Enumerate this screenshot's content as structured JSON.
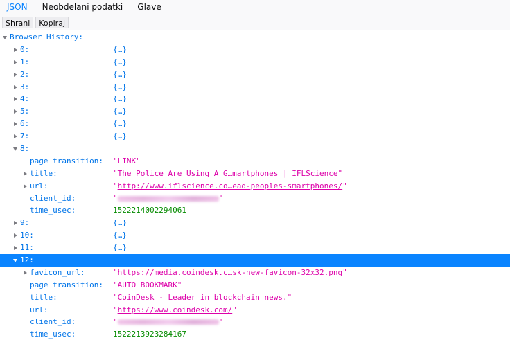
{
  "tabs": [
    {
      "label": "JSON",
      "selected": true
    },
    {
      "label": "Neobdelani podatki",
      "selected": false
    },
    {
      "label": "Glave",
      "selected": false
    }
  ],
  "toolbar": {
    "save_label": "Shrani",
    "copy_label": "Kopiraj"
  },
  "root": {
    "key": "Browser History:"
  },
  "collapsed_value": "{…}",
  "items": {
    "i0": {
      "key": "0:"
    },
    "i1": {
      "key": "1:"
    },
    "i2": {
      "key": "2:"
    },
    "i3": {
      "key": "3:"
    },
    "i4": {
      "key": "4:"
    },
    "i5": {
      "key": "5:"
    },
    "i6": {
      "key": "6:"
    },
    "i7": {
      "key": "7:"
    },
    "i8": {
      "key": "8:",
      "page_transition": {
        "key": "page_transition:",
        "value": "\"LINK\""
      },
      "title": {
        "key": "title:",
        "value": "\"The Police Are Using A G…martphones | IFLScience\""
      },
      "url": {
        "key": "url:",
        "value": "http://www.iflscience.co…ead-peoples-smartphones/"
      },
      "client_id": {
        "key": "client_id:"
      },
      "time_usec": {
        "key": "time_usec:",
        "value": "1522214002294061"
      }
    },
    "i9": {
      "key": "9:"
    },
    "i10": {
      "key": "10:"
    },
    "i11": {
      "key": "11:"
    },
    "i12": {
      "key": "12:",
      "favicon_url": {
        "key": "favicon_url:",
        "value": "https://media.coindesk.c…sk-new-favicon-32x32.png"
      },
      "page_transition": {
        "key": "page_transition:",
        "value": "\"AUTO_BOOKMARK\""
      },
      "title": {
        "key": "title:",
        "value": "\"CoinDesk - Leader in blockchain news.\""
      },
      "url": {
        "key": "url:",
        "value": "https://www.coindesk.com/"
      },
      "client_id": {
        "key": "client_id:"
      },
      "time_usec": {
        "key": "time_usec:",
        "value": "1522213923284167"
      }
    }
  },
  "quote": "\"",
  "colors": {
    "accent": "#0a84ff",
    "key": "#0074e8",
    "string": "#dd00a9",
    "number": "#058b00"
  }
}
